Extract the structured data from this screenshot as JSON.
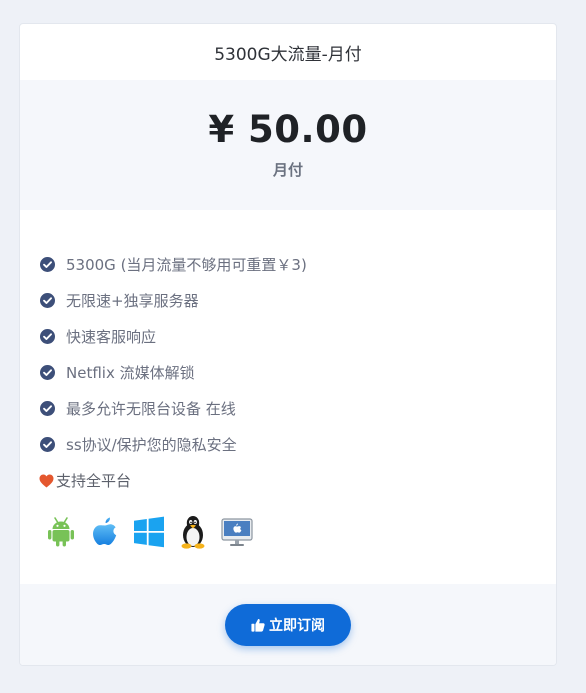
{
  "plan": {
    "title": "5300G大流量-月付",
    "price": "¥ 50.00",
    "period": "月付"
  },
  "features": [
    {
      "text": "5300G (当月流量不够用可重置￥3)",
      "icon": "check-circle-icon"
    },
    {
      "text": "无限速+独享服务器",
      "icon": "check-circle-icon"
    },
    {
      "text": "快速客服响应",
      "icon": "check-circle-icon"
    },
    {
      "text": "Netflix 流媒体解锁",
      "icon": "check-circle-icon"
    },
    {
      "text": "最多允许无限台设备 在线",
      "icon": "check-circle-icon"
    },
    {
      "text": "ss协议/保护您的隐私安全",
      "icon": "check-circle-icon"
    }
  ],
  "support": {
    "text": "支持全平台",
    "icon": "heart-icon"
  },
  "platforms": [
    {
      "name": "android",
      "icon": "android-icon"
    },
    {
      "name": "apple",
      "icon": "apple-icon"
    },
    {
      "name": "windows",
      "icon": "windows-icon"
    },
    {
      "name": "linux",
      "icon": "linux-penguin-icon"
    },
    {
      "name": "macos",
      "icon": "imac-icon"
    }
  ],
  "button": {
    "label": "立即订阅",
    "icon": "thumbs-up-icon"
  },
  "colors": {
    "page_background": "#eef1f7",
    "section_background": "#f5f7fb",
    "check_icon": "#3d4f79",
    "heart": "#e4572e",
    "button": "#0f6bd8"
  }
}
